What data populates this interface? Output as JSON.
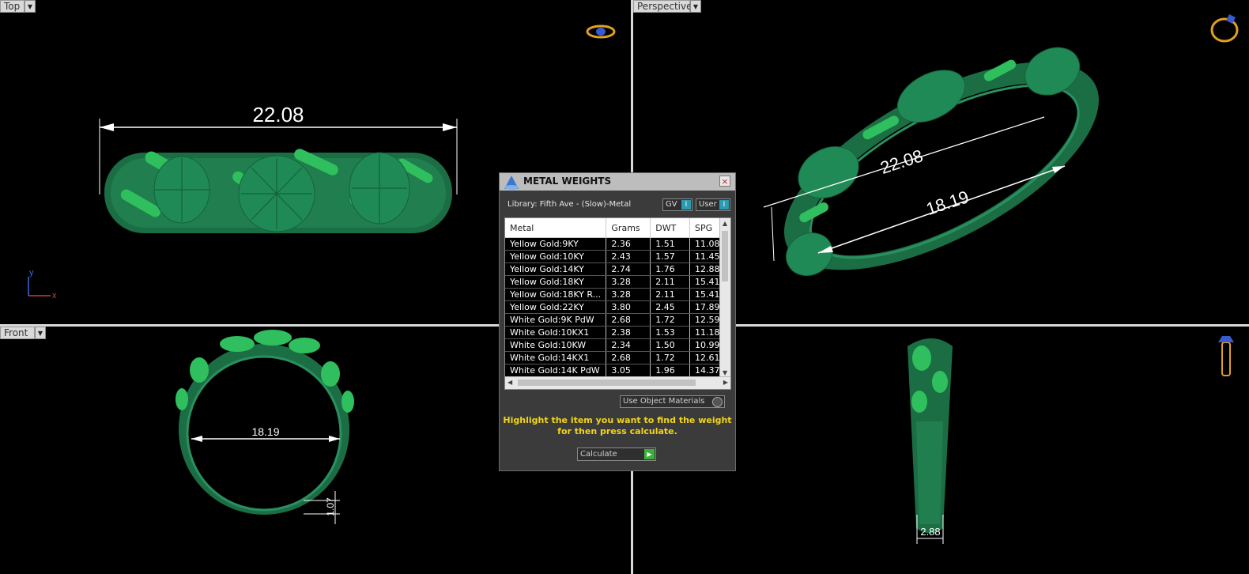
{
  "viewports": {
    "top": {
      "label": "Top",
      "dimension": "22.08",
      "axis_y": "y",
      "axis_x": "x"
    },
    "perspective": {
      "label": "Perspective",
      "dimension_outer": "22.08",
      "dimension_inner": "18.19"
    },
    "front": {
      "label": "Front",
      "dimension_inner": "18.19",
      "dimension_thickness": "1.07"
    },
    "right": {
      "dimension_width": "2.88"
    }
  },
  "dialog": {
    "title": "METAL WEIGHTS",
    "close": "×",
    "library": "Library: Fifth Ave - (Slow)-Metal",
    "toggle_gv": "GV",
    "toggle_user": "User",
    "columns": [
      "Metal",
      "Grams",
      "DWT",
      "SPG"
    ],
    "rows": [
      [
        "Yellow Gold:9KY",
        "2.36",
        "1.51",
        "11.08"
      ],
      [
        "Yellow Gold:10KY",
        "2.43",
        "1.57",
        "11.45"
      ],
      [
        "Yellow Gold:14KY",
        "2.74",
        "1.76",
        "12.88"
      ],
      [
        "Yellow Gold:18KY",
        "3.28",
        "2.11",
        "15.41"
      ],
      [
        "Yellow Gold:18KY R...",
        "3.28",
        "2.11",
        "15.41"
      ],
      [
        "Yellow Gold:22KY",
        "3.80",
        "2.45",
        "17.89"
      ],
      [
        "White Gold:9K PdW",
        "2.68",
        "1.72",
        "12.59"
      ],
      [
        "White Gold:10KX1",
        "2.38",
        "1.53",
        "11.18"
      ],
      [
        "White Gold:10KW",
        "2.34",
        "1.50",
        "10.99"
      ],
      [
        "White Gold:14KX1",
        "2.68",
        "1.72",
        "12.61"
      ],
      [
        "White Gold:14K PdW",
        "3.05",
        "1.96",
        "14.37"
      ]
    ],
    "use_object_materials": "Use Object Materials",
    "hint": "Highlight the item you want to find the weight for then press calculate.",
    "calculate": "Calculate"
  },
  "colors": {
    "ring_dark": "#1d7a4c",
    "ring_light": "#2fbf5e",
    "dimension": "#ffffff",
    "hint": "#f2d51a"
  },
  "icons": [
    "ring-top-icon",
    "ring-perspective-icon",
    "ring-side-icon"
  ]
}
